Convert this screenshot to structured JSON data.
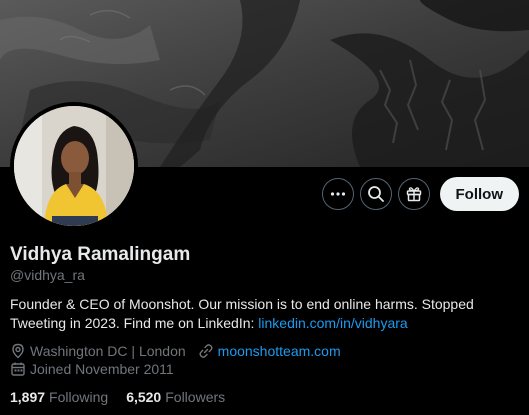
{
  "profile": {
    "name": "Vidhya Ramalingam",
    "handle": "@vidhya_ra",
    "bio_text": "Founder & CEO of Moonshot. Our mission is to end online harms. Stopped Tweeting in 2023. Find me on LinkedIn: ",
    "bio_link": "linkedin.com/in/vidhyara",
    "location": "Washington DC | London",
    "website": "moonshotteam.com",
    "joined": "Joined November 2011"
  },
  "stats": {
    "following_count": "1,897",
    "following_label": "Following",
    "followers_count": "6,520",
    "followers_label": "Followers"
  },
  "actions": {
    "more_icon": "more-icon",
    "search_icon": "search-icon",
    "subscribe_icon": "gift-icon",
    "follow_label": "Follow"
  },
  "colors": {
    "background": "#000000",
    "link": "#1d9bf0",
    "muted": "#71767b",
    "follow_button": "#eff3f4"
  }
}
